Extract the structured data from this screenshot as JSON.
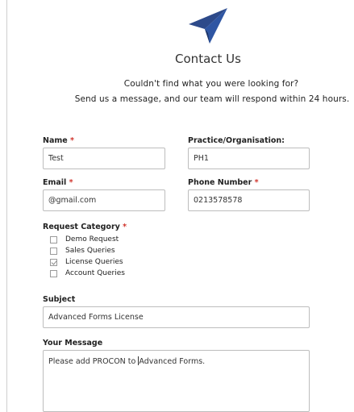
{
  "header": {
    "title": "Contact Us",
    "intro_line1": "Couldn't find what you were looking for?",
    "intro_line2": "Send us a message, and our team will respond within 24 hours."
  },
  "form": {
    "name": {
      "label": "Name",
      "required": "*",
      "value": "Test"
    },
    "practice": {
      "label": "Practice/Organisation:",
      "value": "PH1"
    },
    "email": {
      "label": "Email",
      "required": "*",
      "value": "@gmail.com"
    },
    "phone": {
      "label": "Phone Number",
      "required": "*",
      "value": "0213578578"
    },
    "category": {
      "label": "Request Category",
      "required": "*",
      "options": [
        {
          "label": "Demo Request",
          "checked": false
        },
        {
          "label": "Sales Queries",
          "checked": false
        },
        {
          "label": "License Queries",
          "checked": true
        },
        {
          "label": "Account Queries",
          "checked": false
        }
      ]
    },
    "subject": {
      "label": "Subject",
      "value": "Advanced Forms License"
    },
    "message": {
      "label": "Your Message",
      "value_before_caret": "Please add PROCON to ",
      "value_after_caret": "Advanced Forms."
    }
  },
  "colors": {
    "logo": "#2d4a8a",
    "required": "#d0342c",
    "border": "#bdbdbd"
  },
  "icons": {
    "logo": "paper-plane-icon"
  }
}
